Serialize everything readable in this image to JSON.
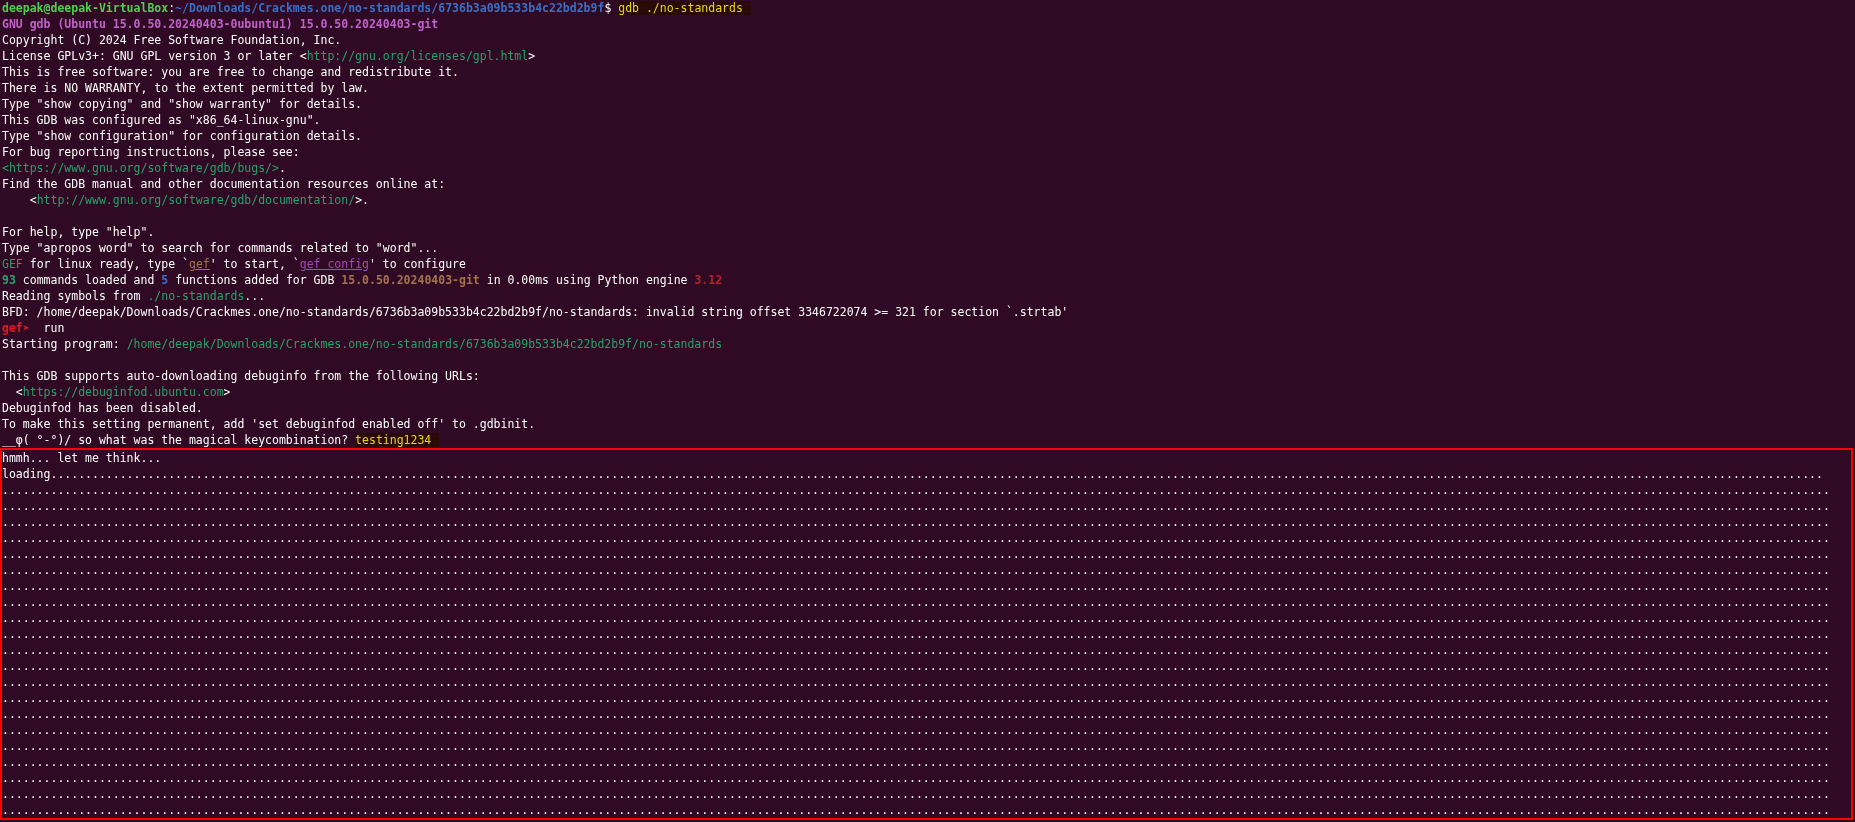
{
  "terminal": {
    "lines": [
      {
        "kind": "text",
        "segments": [
          {
            "text": "deepak@deepak-VirtualBox",
            "kind": "user"
          },
          {
            "text": ":",
            "kind": "plain"
          },
          {
            "text": "~/Downloads/Crackmes.one/no-standards/6736b3a09b533b4c22bd2b9f",
            "kind": "path"
          },
          {
            "text": "$ ",
            "kind": "plain"
          },
          {
            "text": "gdb ./no-standards",
            "kind": "input"
          }
        ]
      },
      {
        "kind": "text",
        "segments": [
          {
            "text": "GNU gdb (Ubuntu 15.0.50.20240403-0ubuntu1) 15.0.50.20240403-git",
            "kind": "heading"
          }
        ]
      },
      {
        "kind": "text",
        "segments": [
          {
            "text": "Copyright (C) 2024 Free Software Foundation, Inc.",
            "kind": "plain"
          }
        ]
      },
      {
        "kind": "text",
        "segments": [
          {
            "text": "License GPLv3+: GNU GPL version 3 or later <",
            "kind": "plain"
          },
          {
            "text": "http://gnu.org/licenses/gpl.html",
            "kind": "link"
          },
          {
            "text": ">",
            "kind": "plain"
          }
        ]
      },
      {
        "kind": "text",
        "segments": [
          {
            "text": "This is free software: you are free to change and redistribute it.",
            "kind": "plain"
          }
        ]
      },
      {
        "kind": "text",
        "segments": [
          {
            "text": "There is NO WARRANTY, to the extent permitted by law.",
            "kind": "plain"
          }
        ]
      },
      {
        "kind": "text",
        "segments": [
          {
            "text": "Type \"show copying\" and \"show warranty\" for details.",
            "kind": "plain"
          }
        ]
      },
      {
        "kind": "text",
        "segments": [
          {
            "text": "This GDB was configured as \"x86_64-linux-gnu\".",
            "kind": "plain"
          }
        ]
      },
      {
        "kind": "text",
        "segments": [
          {
            "text": "Type \"show configuration\" for configuration details.",
            "kind": "plain"
          }
        ]
      },
      {
        "kind": "text",
        "segments": [
          {
            "text": "For bug reporting instructions, please see:",
            "kind": "plain"
          }
        ]
      },
      {
        "kind": "text",
        "segments": [
          {
            "text": "<https://www.gnu.org/software/gdb/bugs/>",
            "kind": "link"
          },
          {
            "text": ".",
            "kind": "plain"
          }
        ]
      },
      {
        "kind": "text",
        "segments": [
          {
            "text": "Find the GDB manual and other documentation resources online at:",
            "kind": "plain"
          }
        ]
      },
      {
        "kind": "text",
        "segments": [
          {
            "text": "    <",
            "kind": "plain"
          },
          {
            "text": "http://www.gnu.org/software/gdb/documentation/",
            "kind": "link"
          },
          {
            "text": ">.",
            "kind": "plain"
          }
        ]
      },
      {
        "kind": "blank"
      },
      {
        "kind": "text",
        "segments": [
          {
            "text": "For help, type \"help\".",
            "kind": "plain"
          }
        ]
      },
      {
        "kind": "text",
        "segments": [
          {
            "text": "Type \"apropos word\" to search for commands related to \"word\"...",
            "kind": "plain"
          }
        ]
      },
      {
        "kind": "text",
        "segments": [
          {
            "text": "GEF",
            "kind": "link"
          },
          {
            "text": " for linux ready, type `",
            "kind": "plain"
          },
          {
            "text": "gef",
            "kind": "cmd"
          },
          {
            "text": "' to start, `",
            "kind": "plain"
          },
          {
            "text": "gef config",
            "kind": "cmd2"
          },
          {
            "text": "' to configure",
            "kind": "plain"
          }
        ]
      },
      {
        "kind": "text",
        "segments": [
          {
            "text": "93",
            "kind": "count"
          },
          {
            "text": " commands loaded and ",
            "kind": "plain"
          },
          {
            "text": "5",
            "kind": "count2"
          },
          {
            "text": " functions added for GDB ",
            "kind": "plain"
          },
          {
            "text": "15.0.50.20240403-git",
            "kind": "version"
          },
          {
            "text": " in 0.00ms using Python engine ",
            "kind": "plain"
          },
          {
            "text": "3.12",
            "kind": "alert"
          }
        ]
      },
      {
        "kind": "text",
        "segments": [
          {
            "text": "Reading symbols from ",
            "kind": "plain"
          },
          {
            "text": "./no-standards",
            "kind": "link"
          },
          {
            "text": "...",
            "kind": "plain"
          }
        ]
      },
      {
        "kind": "text",
        "segments": [
          {
            "text": "BFD: /home/deepak/Downloads/Crackmes.one/no-standards/6736b3a09b533b4c22bd2b9f/no-standards: invalid string offset 3346722074 >= 321 for section `.strtab'",
            "kind": "plain"
          }
        ]
      },
      {
        "kind": "text",
        "segments": [
          {
            "text": "gef➤",
            "kind": "prompt"
          },
          {
            "text": "  run",
            "kind": "plain"
          }
        ]
      },
      {
        "kind": "text",
        "segments": [
          {
            "text": "Starting program: ",
            "kind": "plain"
          },
          {
            "text": "/home/deepak/Downloads/Crackmes.one/no-standards/6736b3a09b533b4c22bd2b9f/no-standards",
            "kind": "link"
          }
        ]
      },
      {
        "kind": "blank"
      },
      {
        "kind": "text",
        "segments": [
          {
            "text": "This GDB supports auto-downloading debuginfo from the following URLs:",
            "kind": "plain"
          }
        ]
      },
      {
        "kind": "text",
        "segments": [
          {
            "text": "  <",
            "kind": "plain"
          },
          {
            "text": "https://debuginfod.ubuntu.com",
            "kind": "link"
          },
          {
            "text": ">",
            "kind": "plain"
          }
        ]
      },
      {
        "kind": "text",
        "segments": [
          {
            "text": "Debuginfod has been disabled.",
            "kind": "plain"
          }
        ]
      },
      {
        "kind": "text",
        "segments": [
          {
            "text": "To make this setting permanent, add 'set debuginfod enabled off' to .gdbinit.",
            "kind": "plain"
          }
        ]
      },
      {
        "kind": "text",
        "segments": [
          {
            "text": "__φ( °-°)/ so what was the magical keycombination? ",
            "kind": "plain"
          },
          {
            "text": "testing1234",
            "kind": "input"
          }
        ]
      }
    ],
    "highlighted_output": [
      "hmmh... let me think...",
      "loading................................................................................................................................................................................................................................................................",
      "........................................................................................................................................................................................................................................................................",
      "........................................................................................................................................................................................................................................................................",
      "........................................................................................................................................................................................................................................................................",
      "........................................................................................................................................................................................................................................................................",
      "........................................................................................................................................................................................................................................................................",
      "........................................................................................................................................................................................................................................................................",
      "........................................................................................................................................................................................................................................................................",
      "........................................................................................................................................................................................................................................................................",
      "........................................................................................................................................................................................................................................................................",
      "........................................................................................................................................................................................................................................................................",
      "........................................................................................................................................................................................................................................................................",
      "........................................................................................................................................................................................................................................................................",
      "........................................................................................................................................................................................................................................................................",
      "........................................................................................................................................................................................................................................................................",
      "........................................................................................................................................................................................................................................................................",
      "........................................................................................................................................................................................................................................................................",
      "........................................................................................................................................................................................................................................................................",
      "........................................................................................................................................................................................................................................................................",
      "........................................................................................................................................................................................................................................................................",
      "........................................................................................................................................................................................................................................................................",
      "........................................................................................................................................................................................................................................................................"
    ]
  }
}
